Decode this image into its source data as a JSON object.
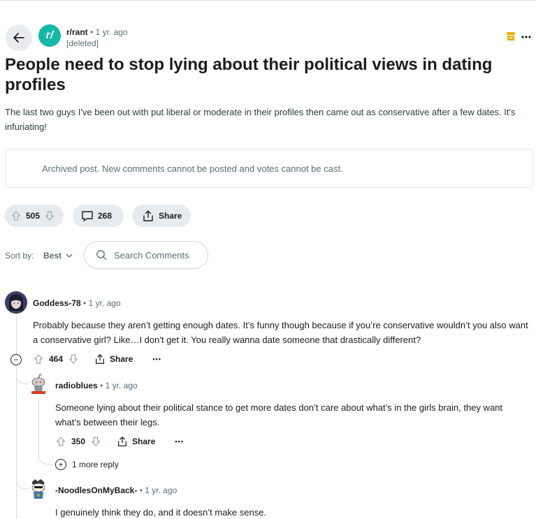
{
  "post": {
    "subreddit": "r/rant",
    "subreddit_icon_letter": "r/",
    "separator": "•",
    "time": "1 yr. ago",
    "author": "[deleted]",
    "more": "•••",
    "title": "People need to stop lying about their political views in dating profiles",
    "body": "The last two guys I've been out with put liberal or moderate in their profiles then came out as conservative after a few dates. It's infuriating!",
    "archived_notice": "Archived post. New comments cannot be posted and votes cannot be cast.",
    "votes": "505",
    "comments": "268",
    "share_label": "Share"
  },
  "sort": {
    "label": "Sort by:",
    "value": "Best"
  },
  "search": {
    "placeholder": "Search Comments"
  },
  "comments": [
    {
      "author": "Goddess-78",
      "separator": "•",
      "time": "1 yr. ago",
      "text": "Probably because they aren’t getting enough dates. It’s funny though because if you’re conservative wouldn’t you also want a conservative girl? Like…I don't get it. You really wanna date someone that drastically different?",
      "votes": "464",
      "share_label": "Share",
      "more": "•••",
      "collapse_symbol": "−"
    },
    {
      "author": "radioblues",
      "separator": "•",
      "time": "1 yr. ago",
      "text": "Someone lying about their political stance to get more dates don’t care about what’s in the girls brain, they want what’s between their legs.",
      "votes": "350",
      "share_label": "Share",
      "more": "•••",
      "more_replies": "1 more reply",
      "expand_symbol": "+"
    },
    {
      "author": "-NoodlesOnMyBack-",
      "separator": "•",
      "time": "1 yr. ago",
      "text": "I genuinely think they do, and it doesn’t make sense."
    }
  ],
  "colors": {
    "subreddit_icon": "#14b8a6",
    "pill_bg": "#e5ebee",
    "muted_text": "#576f76",
    "save_icon": "#e8b500"
  }
}
